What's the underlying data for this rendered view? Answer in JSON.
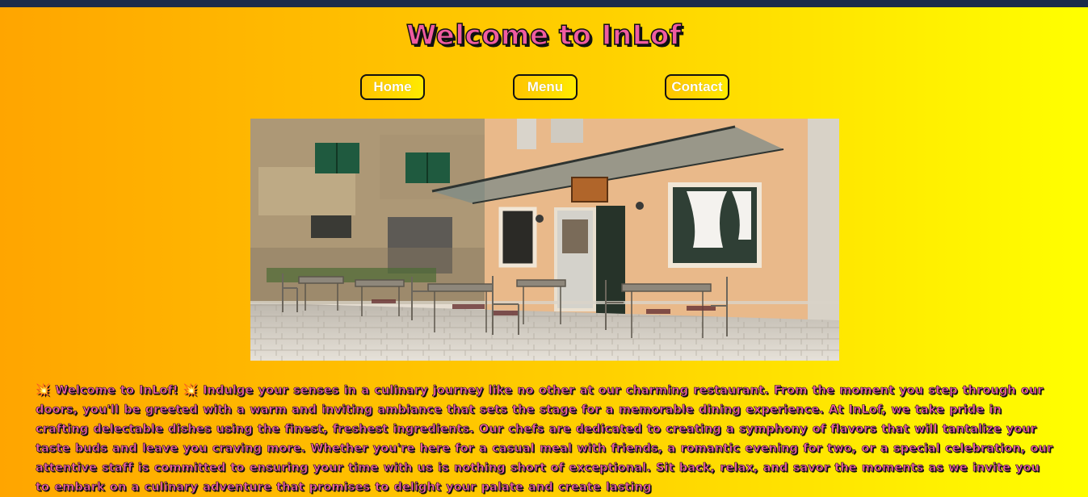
{
  "header": {
    "title": "Welcome to InLof"
  },
  "nav": {
    "home_label": "Home",
    "menu_label": "Menu",
    "contact_label": "Contact"
  },
  "hero": {
    "sign_text": ""
  },
  "intro": {
    "text": "💥 Welcome to InLof! 💥 Indulge your senses in a culinary journey like no other at our charming restaurant. From the moment you step through our doors, you'll be greeted with a warm and inviting ambiance that sets the stage for a memorable dining experience. At InLof, we take pride in crafting delectable dishes using the finest, freshest ingredients. Our chefs are dedicated to creating a symphony of flavors that will tantalize your taste buds and leave you craving more. Whether you're here for a casual meal with friends, a romantic evening for two, or a special celebration, our attentive staff is committed to ensuring your time with us is nothing short of exceptional. Sit back, relax, and savor the moments as we invite you to embark on a culinary adventure that promises to delight your palate and create lasting"
  },
  "colors": {
    "topbar": "#1c2c4a",
    "gradient_start": "#ffa500",
    "gradient_end": "#ffff00",
    "title_fill": "#f05ca0",
    "outline": "#111111"
  }
}
